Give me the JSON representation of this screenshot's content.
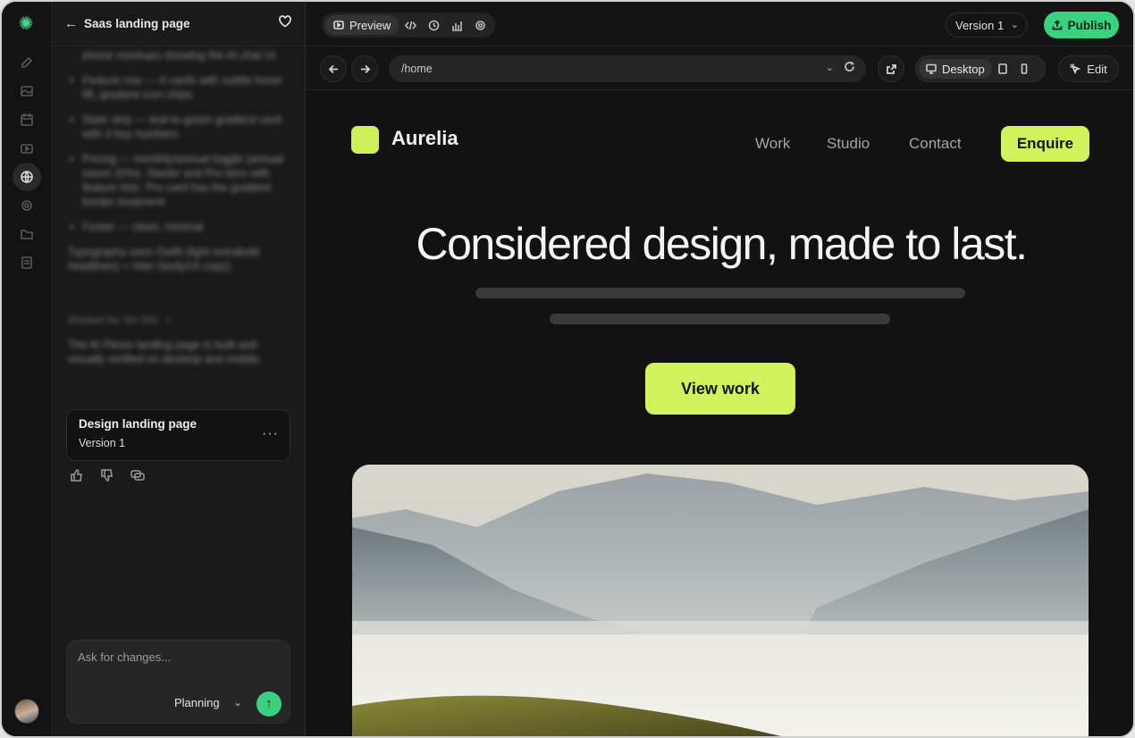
{
  "chat": {
    "header_title": "Saas landing page",
    "messages": [
      "phone mockups showing the AI chat UI.",
      "Feature row — 4 cards with subtle hover lift, gradient icon chips",
      "Stats strip — teal-to-green gradient card with 3 key numbers",
      "Pricing — monthly/annual toggle (annual saves 20%). Starter and Pro tiers with feature lists. Pro card has the gradient border treatment",
      "Footer — clean, minimal"
    ],
    "typography_note": "Typography uses Outfit (light extrabold headlines) + Inter (body/UI copy).",
    "worked_for": "Worked for 3m 50s",
    "summary": "The AI Flexio landing page is built and visually verified on desktop and mobile.",
    "card_title": "Design landing page",
    "card_version": "Version 1",
    "card_more": "···",
    "input_placeholder": "Ask for changes...",
    "mode_label": "Planning"
  },
  "toolbar": {
    "preview_label": "Preview",
    "version_label": "Version 1",
    "publish_label": "Publish"
  },
  "address": {
    "url": "/home",
    "device_label": "Desktop",
    "edit_label": "Edit"
  },
  "site": {
    "brand": "Aurelia",
    "nav": [
      "Work",
      "Studio",
      "Contact"
    ],
    "enquire_label": "Enquire",
    "hero_title": "Considered design, made to last.",
    "cta_label": "View work"
  },
  "colors": {
    "accent_green": "#3ad27f",
    "site_lime": "#d2f25b"
  }
}
